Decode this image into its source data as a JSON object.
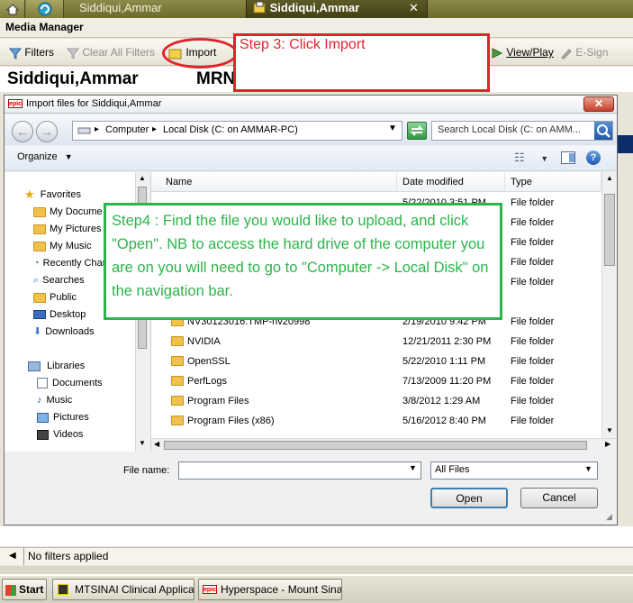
{
  "top_tabs": [
    {
      "label": "Siddiqui,Ammar"
    },
    {
      "label": "Siddiqui,Ammar"
    }
  ],
  "close_glyph": "✕",
  "media_manager": {
    "title": "Media Manager",
    "toolbar": {
      "filters": "Filters",
      "clear_all_filters": "Clear All Filters",
      "import": "Import",
      "view_play": "View/Play",
      "e_sign": "E-Sign"
    },
    "patient_name": "Siddiqui,Ammar",
    "mrn_label": "MRN: 36"
  },
  "dialog": {
    "title": "Import files for Siddiqui,Ammar",
    "breadcrumb": [
      "Computer",
      "Local Disk (C: on AMMAR-PC)"
    ],
    "search_placeholder": "Search Local Disk (C: on AMM...",
    "organize": "Organize",
    "nav": {
      "favorites_header": "Favorites",
      "favorites": [
        "My Docume",
        "My Pictures",
        "My Music",
        "Recently Char",
        "Searches",
        "Public",
        "Desktop",
        "Downloads"
      ],
      "libraries_header": "Libraries",
      "libraries": [
        "Documents",
        "Music",
        "Pictures",
        "Videos"
      ]
    },
    "columns": {
      "name": "Name",
      "date_modified": "Date modified",
      "type": "Type"
    },
    "files": [
      {
        "name": "NV30123016.TMP-nv20998",
        "date": "2/19/2010 9:42 PM",
        "type": "File folder"
      },
      {
        "name": "NVIDIA",
        "date": "12/21/2011 2:30 PM",
        "type": "File folder"
      },
      {
        "name": "OpenSSL",
        "date": "5/22/2010 1:11 PM",
        "type": "File folder"
      },
      {
        "name": "PerfLogs",
        "date": "7/13/2009 11:20 PM",
        "type": "File folder"
      },
      {
        "name": "Program Files",
        "date": "3/8/2012 1:29 AM",
        "type": "File folder"
      },
      {
        "name": "Program Files (x86)",
        "date": "5/16/2012 8:40 PM",
        "type": "File folder"
      }
    ],
    "partial_row": {
      "date": "5/22/2010 3:51 PM"
    },
    "hidden_rows_type": [
      "File folder",
      "File folder",
      "File folder",
      "File folder",
      "File folder"
    ],
    "file_name_label": "File name:",
    "file_name_value": "",
    "file_type_filter": "All Files",
    "open_button": "Open",
    "cancel_button": "Cancel"
  },
  "annotations": {
    "step3": "Step 3: Click Import",
    "step4": "Step4 : Find the file you would like to upload, and click \"Open\". NB to access the hard drive of the computer you are on you will need to go to \"Computer -> Local Disk\" on the navigation bar."
  },
  "filter_status": "No filters applied",
  "taskbar": {
    "start": "Start",
    "items": [
      "MTSINAI Clinical Applicati...",
      "Hyperspace - Mount Sina..."
    ]
  },
  "colors": {
    "step3_border": "#e0242c",
    "step4_border": "#2bb54a"
  }
}
